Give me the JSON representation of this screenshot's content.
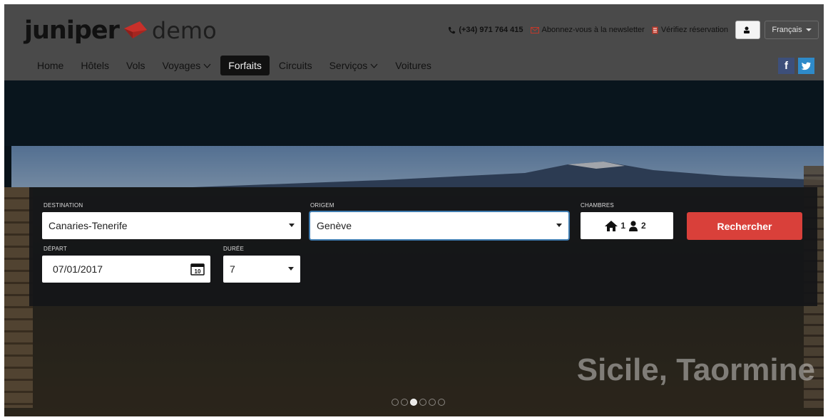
{
  "header": {
    "logo": {
      "brand": "juniper",
      "suffix": "demo"
    },
    "topbar": {
      "phone": "(+34) 971 764 415",
      "newsletter": "Abonnez-vous à la newsletter",
      "reservation": "Vérifiez réservation",
      "language": "Français"
    },
    "nav": [
      {
        "label": "Home"
      },
      {
        "label": "Hôtels"
      },
      {
        "label": "Vols"
      },
      {
        "label": "Voyages"
      },
      {
        "label": "Forfaits"
      },
      {
        "label": "Circuits"
      },
      {
        "label": "Serviços"
      },
      {
        "label": "Voitures"
      }
    ],
    "social": {
      "facebook": "f"
    }
  },
  "search": {
    "destination": {
      "label": "DESTINATION",
      "value": "Canaries-Tenerife"
    },
    "origin": {
      "label": "ORIGEM",
      "value": "Genève"
    },
    "rooms": {
      "label": "CHAMBRES",
      "rooms": "1",
      "adults": "2"
    },
    "departure": {
      "label": "DÉPART",
      "value": "07/01/2017",
      "calendar_day": "10"
    },
    "duration": {
      "label": "DURÉE",
      "value": "7"
    },
    "submit": "Rechercher"
  },
  "hero": {
    "caption": "Sicile, Taormine",
    "slides_total": 6,
    "active_slide": 3
  },
  "colors": {
    "header_bg": "#4a4a4a",
    "brand_red": "#d9403a",
    "active_nav": "#111111",
    "facebook": "#3d4f7a",
    "twitter": "#2e8ac9"
  },
  "icons": [
    "phone-icon",
    "envelope-icon",
    "document-icon",
    "user-icon",
    "caret-down-icon",
    "facebook-icon",
    "twitter-icon",
    "calendar-icon",
    "house-icon",
    "person-icon"
  ]
}
